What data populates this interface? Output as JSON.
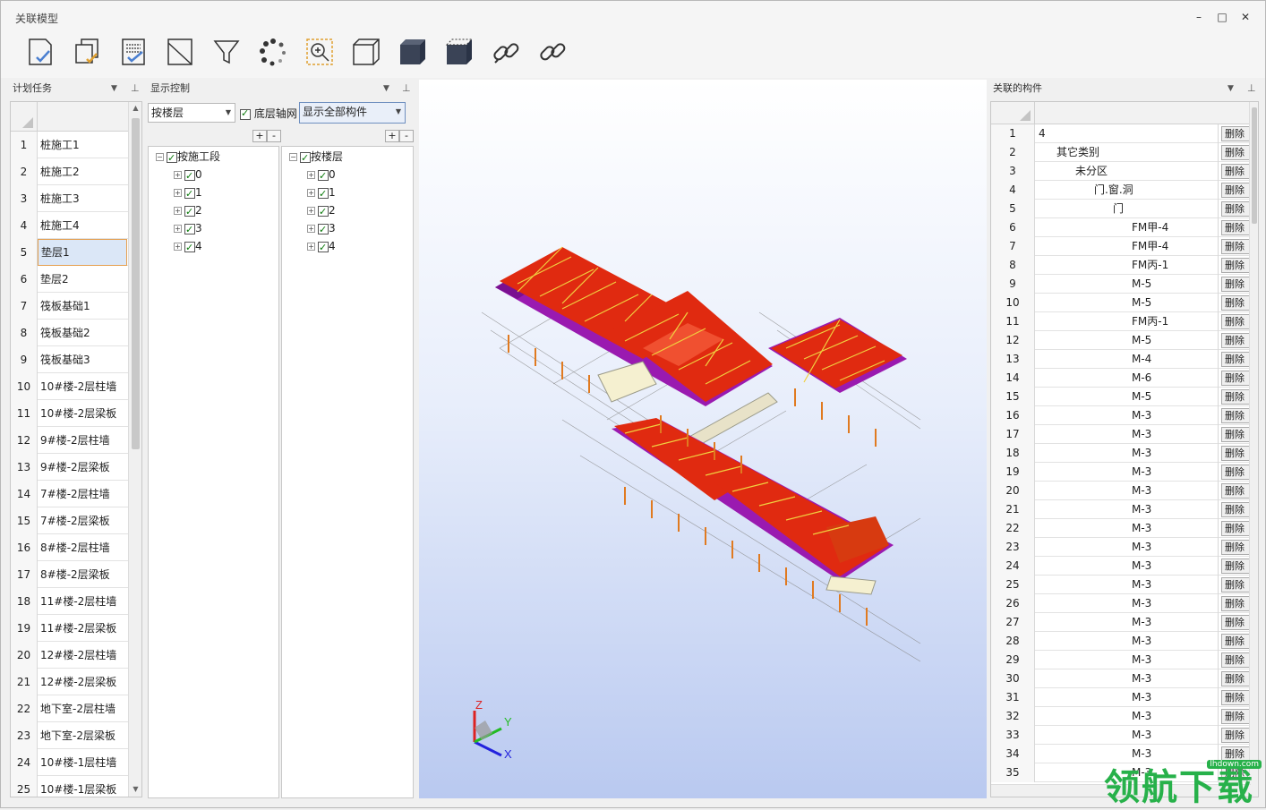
{
  "window": {
    "title": "关联模型",
    "minimize": "–",
    "maximize": "□",
    "close": "✕"
  },
  "toolbar": {
    "icons": [
      "select-icon",
      "copy-check-icon",
      "list-check-icon",
      "section-icon",
      "filter-icon",
      "loading-spinner-icon",
      "zoom-region-icon",
      "wireframe-box-icon",
      "solid-box-icon",
      "shaded-box-icon",
      "link-icon",
      "unlink-icon"
    ]
  },
  "plan": {
    "title": "计划任务",
    "rows": [
      {
        "num": "1",
        "text": "桩施工1"
      },
      {
        "num": "2",
        "text": "桩施工2"
      },
      {
        "num": "3",
        "text": "桩施工3"
      },
      {
        "num": "4",
        "text": "桩施工4"
      },
      {
        "num": "5",
        "text": "垫层1"
      },
      {
        "num": "6",
        "text": "垫层2"
      },
      {
        "num": "7",
        "text": "筏板基础1"
      },
      {
        "num": "8",
        "text": "筏板基础2"
      },
      {
        "num": "9",
        "text": "筏板基础3"
      },
      {
        "num": "10",
        "text": "10#楼-2层柱墙"
      },
      {
        "num": "11",
        "text": "10#楼-2层梁板"
      },
      {
        "num": "12",
        "text": "9#楼-2层柱墙"
      },
      {
        "num": "13",
        "text": "9#楼-2层梁板"
      },
      {
        "num": "14",
        "text": "7#楼-2层柱墙"
      },
      {
        "num": "15",
        "text": "7#楼-2层梁板"
      },
      {
        "num": "16",
        "text": "8#楼-2层柱墙"
      },
      {
        "num": "17",
        "text": "8#楼-2层梁板"
      },
      {
        "num": "18",
        "text": "11#楼-2层柱墙"
      },
      {
        "num": "19",
        "text": "11#楼-2层梁板"
      },
      {
        "num": "20",
        "text": "12#楼-2层柱墙"
      },
      {
        "num": "21",
        "text": "12#楼-2层梁板"
      },
      {
        "num": "22",
        "text": "地下室-2层柱墙"
      },
      {
        "num": "23",
        "text": "地下室-2层梁板"
      },
      {
        "num": "24",
        "text": "10#楼-1层柱墙"
      },
      {
        "num": "25",
        "text": "10#楼-1层梁板"
      }
    ],
    "selected_index": 4
  },
  "display": {
    "title": "显示控制",
    "group_select": "按楼层",
    "axis_label": "底层轴网",
    "axis_checked": true,
    "show_select": "显示全部构件",
    "plus": "+",
    "minus": "-",
    "tree_left": {
      "root": "按施工段",
      "children": [
        "0",
        "1",
        "2",
        "3",
        "4"
      ]
    },
    "tree_right": {
      "root": "按楼层",
      "children": [
        "0",
        "1",
        "2",
        "3",
        "4"
      ]
    }
  },
  "viewport": {
    "axes": {
      "z": "Z",
      "y": "Y",
      "x": "X"
    },
    "colors": {
      "roof": "#e02a10",
      "wall": "#b020c0",
      "truss": "#f0d040",
      "pile": "#e07a20",
      "bg_bottom": "#b9c9f0"
    }
  },
  "linked": {
    "title": "关联的构件",
    "delete_label": "删除",
    "rows": [
      {
        "num": "1",
        "value": "4",
        "indent": 0
      },
      {
        "num": "2",
        "value": "其它类别",
        "indent": 1
      },
      {
        "num": "3",
        "value": "未分区",
        "indent": 2
      },
      {
        "num": "4",
        "value": "门.窗.洞",
        "indent": 3
      },
      {
        "num": "5",
        "value": "门",
        "indent": 4
      },
      {
        "num": "6",
        "value": "FM甲-4",
        "indent": 5
      },
      {
        "num": "7",
        "value": "FM甲-4",
        "indent": 5
      },
      {
        "num": "8",
        "value": "FM丙-1",
        "indent": 5
      },
      {
        "num": "9",
        "value": "M-5",
        "indent": 5
      },
      {
        "num": "10",
        "value": "M-5",
        "indent": 5
      },
      {
        "num": "11",
        "value": "FM丙-1",
        "indent": 5
      },
      {
        "num": "12",
        "value": "M-5",
        "indent": 5
      },
      {
        "num": "13",
        "value": "M-4",
        "indent": 5
      },
      {
        "num": "14",
        "value": "M-6",
        "indent": 5
      },
      {
        "num": "15",
        "value": "M-5",
        "indent": 5
      },
      {
        "num": "16",
        "value": "M-3",
        "indent": 5
      },
      {
        "num": "17",
        "value": "M-3",
        "indent": 5
      },
      {
        "num": "18",
        "value": "M-3",
        "indent": 5
      },
      {
        "num": "19",
        "value": "M-3",
        "indent": 5
      },
      {
        "num": "20",
        "value": "M-3",
        "indent": 5
      },
      {
        "num": "21",
        "value": "M-3",
        "indent": 5
      },
      {
        "num": "22",
        "value": "M-3",
        "indent": 5
      },
      {
        "num": "23",
        "value": "M-3",
        "indent": 5
      },
      {
        "num": "24",
        "value": "M-3",
        "indent": 5
      },
      {
        "num": "25",
        "value": "M-3",
        "indent": 5
      },
      {
        "num": "26",
        "value": "M-3",
        "indent": 5
      },
      {
        "num": "27",
        "value": "M-3",
        "indent": 5
      },
      {
        "num": "28",
        "value": "M-3",
        "indent": 5
      },
      {
        "num": "29",
        "value": "M-3",
        "indent": 5
      },
      {
        "num": "30",
        "value": "M-3",
        "indent": 5
      },
      {
        "num": "31",
        "value": "M-3",
        "indent": 5
      },
      {
        "num": "32",
        "value": "M-3",
        "indent": 5
      },
      {
        "num": "33",
        "value": "M-3",
        "indent": 5
      },
      {
        "num": "34",
        "value": "M-3",
        "indent": 5
      },
      {
        "num": "35",
        "value": "M-3",
        "indent": 5
      }
    ]
  },
  "watermark": {
    "text": "领航下载",
    "url": "lhdown.com"
  }
}
